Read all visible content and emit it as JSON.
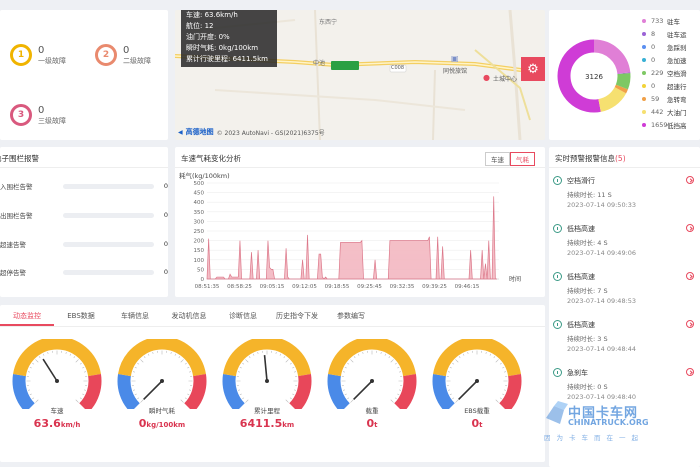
{
  "faults": [
    {
      "count": "0",
      "label": "一级故障",
      "digit": "1",
      "color": "#f0b400"
    },
    {
      "count": "0",
      "label": "二级故障",
      "digit": "2",
      "color": "#e98a6e"
    },
    {
      "count": "0",
      "label": "三级故障",
      "digit": "3",
      "color": "#d9597e"
    }
  ],
  "map": {
    "tooltip": {
      "speed": "车速: 63.6km/h",
      "angle": "航位: 12",
      "throttle": "油门开度: 0%",
      "fuel": "瞬时气耗: 0kg/100km",
      "mileage": "累计行驶里程: 6411.5km"
    },
    "place_labels": [
      "东西宁",
      "中池",
      "同悦旅馆",
      "土城中心",
      "C008"
    ],
    "logo": "高德地图",
    "copyright": "© 2023 AutoNavi - GS(2021)6375号",
    "settings_icon": "gear-icon"
  },
  "donut": {
    "center": "3126",
    "legend": [
      {
        "value": "733",
        "name": "驻车",
        "color": "#e07fd6"
      },
      {
        "value": "8",
        "name": "驻车运",
        "color": "#9b63d6"
      },
      {
        "value": "0",
        "name": "急踩刹",
        "color": "#5b8ff0"
      },
      {
        "value": "0",
        "name": "急加速",
        "color": "#38b0d4"
      },
      {
        "value": "229",
        "name": "空档滑",
        "color": "#7ec864"
      },
      {
        "value": "0",
        "name": "超速行",
        "color": "#f2d338"
      },
      {
        "value": "59",
        "name": "急转弯",
        "color": "#f0a048"
      },
      {
        "value": "442",
        "name": "大油门",
        "color": "#f6e070"
      },
      {
        "value": "1659",
        "name": "低挡高",
        "color": "#cf3cd6"
      }
    ]
  },
  "fence": {
    "title": "电子围栏报警",
    "rows": [
      {
        "label": "入围栏告警",
        "value": "0"
      },
      {
        "label": "出围栏告警",
        "value": "0"
      },
      {
        "label": "超速告警",
        "value": "0"
      },
      {
        "label": "超停告警",
        "value": "0"
      }
    ]
  },
  "fuel": {
    "title": "车速气耗变化分析",
    "tabs": [
      "车速",
      "气耗"
    ],
    "active_tab": "气耗"
  },
  "chart_data": {
    "type": "area",
    "ylabel": "耗气(kg/100km)",
    "xlabel": "时间",
    "ylim": [
      0,
      500
    ],
    "yticks": [
      0,
      50,
      100,
      150,
      200,
      250,
      300,
      350,
      400,
      450,
      500
    ],
    "x_ticks": [
      "08:51:35",
      "08:58:25",
      "09:05:15",
      "09:12:05",
      "09:18:55",
      "09:25:45",
      "09:32:35",
      "09:39:25",
      "09:46:15"
    ],
    "values": [
      0,
      210,
      0,
      0,
      0,
      0,
      10,
      10,
      10,
      10,
      10,
      0,
      0,
      0,
      25,
      10,
      10,
      10,
      10,
      10,
      200,
      0,
      0,
      0,
      0,
      0,
      0,
      140,
      0,
      0,
      0,
      150,
      0,
      0,
      0,
      0,
      0,
      200,
      60,
      50,
      50,
      0,
      0,
      0,
      0,
      0,
      0,
      0,
      160,
      10,
      0,
      0,
      0,
      0,
      0,
      0,
      0,
      0,
      100,
      0,
      0,
      230,
      0,
      0,
      0,
      0,
      0,
      0,
      130,
      130,
      10,
      0,
      10,
      0,
      0,
      0,
      0,
      0,
      0,
      0,
      0,
      190,
      190,
      190,
      190,
      190,
      190,
      190,
      190,
      190,
      190,
      190,
      190,
      190,
      200,
      0,
      0,
      0,
      0,
      0,
      0,
      0,
      100,
      0,
      0,
      0,
      0,
      0,
      0,
      0,
      0,
      200,
      200,
      200,
      200,
      200,
      200,
      200,
      200,
      200,
      200,
      200,
      200,
      200,
      200,
      200,
      200,
      200,
      200,
      200,
      200,
      200,
      200,
      200,
      200,
      220,
      0,
      0,
      0,
      0,
      220,
      0,
      0,
      170,
      0,
      0,
      0,
      0,
      0,
      0,
      0,
      0,
      0,
      0,
      0,
      0,
      0,
      0,
      0,
      0,
      150,
      0,
      0,
      0,
      0,
      0,
      0,
      150,
      0,
      80,
      0,
      200,
      0,
      0,
      430,
      0,
      0
    ]
  },
  "alarms": {
    "title": "实时预警报警信息",
    "count": "(5)",
    "items": [
      {
        "type": "空档滑行",
        "duration": "持续时长: 11 S",
        "time": "2023-07-14 09:50:33"
      },
      {
        "type": "低档高速",
        "duration": "持续时长: 4 S",
        "time": "2023-07-14 09:49:06"
      },
      {
        "type": "低档高速",
        "duration": "持续时长: 7 S",
        "time": "2023-07-14 09:48:53"
      },
      {
        "type": "低档高速",
        "duration": "持续时长: 3 S",
        "time": "2023-07-14 09:48:44"
      },
      {
        "type": "急刹车",
        "duration": "持续时长: 0 S",
        "time": "2023-07-14 09:48:40"
      }
    ]
  },
  "gauge_tabs": [
    "动态监控",
    "EBS数据",
    "车辆信息",
    "发动机信息",
    "诊断信息",
    "历史指令下发",
    "参数编写"
  ],
  "active_gauge_tab": "动态监控",
  "gauges": [
    {
      "label": "车速",
      "value": "63.6",
      "unit": "km/h",
      "level": 0.38
    },
    {
      "label": "瞬时气耗",
      "value": "0",
      "unit": "kg/100km",
      "level": 0.0
    },
    {
      "label": "累计里程",
      "value": "6411.5",
      "unit": "km",
      "level": 0.48
    },
    {
      "label": "载重",
      "value": "0",
      "unit": "t",
      "level": 0.0
    },
    {
      "label": "EBS载重",
      "value": "0",
      "unit": "t",
      "level": 0.0
    }
  ],
  "watermark": {
    "cn": "中国卡车网",
    "en": "CHINATRUCK.ORG",
    "sub": "因为卡车而在一起"
  },
  "colors": {
    "accent": "#e84a5f",
    "chart_fill": "#f3b8c1",
    "chart_line": "#d96a7e"
  }
}
